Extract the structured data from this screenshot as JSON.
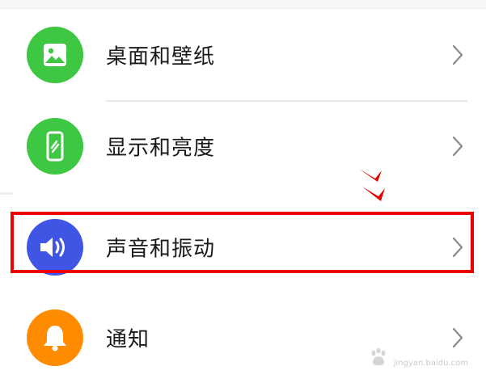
{
  "settings_list": {
    "items": [
      {
        "label": "桌面和壁纸",
        "icon": "image-icon",
        "icon_color": "#3dc742"
      },
      {
        "label": "显示和亮度",
        "icon": "phone-icon",
        "icon_color": "#3dc742"
      },
      {
        "label": "声音和振动",
        "icon": "speaker-icon",
        "icon_color": "#3f56e4"
      },
      {
        "label": "通知",
        "icon": "bell-icon",
        "icon_color": "#ff8c00"
      }
    ]
  },
  "annotation": {
    "highlight_color": "#ee0000",
    "highlighted_item": "声音和振动"
  },
  "watermark": {
    "text": "jingyan.baidu.com"
  }
}
